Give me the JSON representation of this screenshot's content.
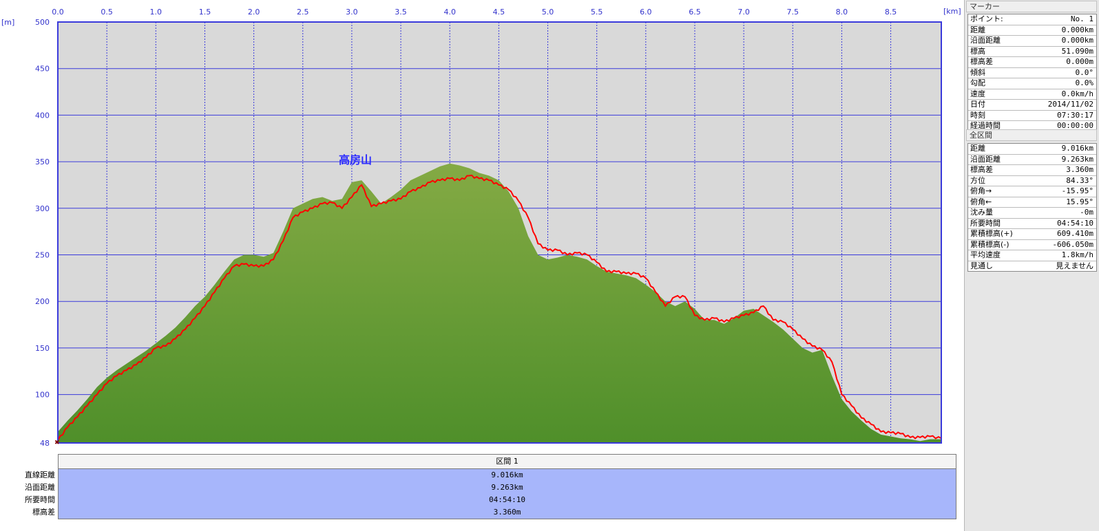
{
  "chart_data": {
    "type": "area",
    "title": "高房山",
    "x_unit": "[km]",
    "y_unit": "[m]",
    "xlim": [
      0,
      9.016
    ],
    "ylim": [
      48,
      500
    ],
    "x_ticks": [
      "0.0",
      "0.5",
      "1.0",
      "1.5",
      "2.0",
      "2.5",
      "3.0",
      "3.5",
      "4.0",
      "4.5",
      "5.0",
      "5.5",
      "6.0",
      "6.5",
      "7.0",
      "7.5",
      "8.0",
      "8.5"
    ],
    "y_ticks": [
      "500",
      "450",
      "400",
      "350",
      "300",
      "250",
      "200",
      "150",
      "100",
      "48"
    ],
    "grid": true,
    "series": [
      {
        "style": "area",
        "color": "#6b9a3a",
        "x": [
          0,
          0.1,
          0.2,
          0.3,
          0.4,
          0.5,
          0.6,
          0.7,
          0.8,
          0.9,
          1.0,
          1.1,
          1.2,
          1.3,
          1.4,
          1.5,
          1.6,
          1.7,
          1.8,
          1.9,
          2.0,
          2.1,
          2.2,
          2.3,
          2.4,
          2.5,
          2.6,
          2.7,
          2.8,
          2.9,
          3.0,
          3.1,
          3.2,
          3.3,
          3.4,
          3.5,
          3.6,
          3.7,
          3.8,
          3.9,
          4.0,
          4.1,
          4.2,
          4.3,
          4.4,
          4.5,
          4.6,
          4.7,
          4.8,
          4.9,
          5.0,
          5.1,
          5.2,
          5.3,
          5.4,
          5.5,
          5.6,
          5.7,
          5.8,
          5.9,
          6.0,
          6.1,
          6.2,
          6.3,
          6.4,
          6.5,
          6.6,
          6.7,
          6.8,
          6.9,
          7.0,
          7.1,
          7.2,
          7.3,
          7.4,
          7.5,
          7.6,
          7.7,
          7.8,
          7.9,
          8.0,
          8.1,
          8.2,
          8.3,
          8.4,
          8.5,
          8.6,
          8.7,
          8.8,
          8.9,
          9.016
        ],
        "y": [
          60,
          72,
          83,
          95,
          108,
          118,
          126,
          133,
          140,
          147,
          155,
          163,
          172,
          183,
          195,
          205,
          218,
          232,
          245,
          250,
          250,
          248,
          252,
          275,
          300,
          305,
          310,
          312,
          308,
          310,
          328,
          330,
          318,
          305,
          312,
          320,
          330,
          335,
          340,
          345,
          348,
          346,
          343,
          338,
          335,
          330,
          318,
          300,
          270,
          250,
          245,
          247,
          250,
          248,
          245,
          238,
          232,
          230,
          228,
          225,
          218,
          210,
          200,
          195,
          200,
          192,
          180,
          180,
          176,
          182,
          190,
          192,
          185,
          178,
          170,
          160,
          150,
          145,
          148,
          120,
          95,
          82,
          72,
          63,
          57,
          55,
          53,
          52,
          50,
          52,
          52
        ]
      },
      {
        "style": "line",
        "color": "#ff0000",
        "x": [
          0,
          0.1,
          0.2,
          0.3,
          0.4,
          0.5,
          0.6,
          0.7,
          0.8,
          0.9,
          1.0,
          1.1,
          1.2,
          1.3,
          1.4,
          1.5,
          1.6,
          1.7,
          1.8,
          1.9,
          2.0,
          2.1,
          2.2,
          2.3,
          2.4,
          2.5,
          2.6,
          2.7,
          2.8,
          2.9,
          3.0,
          3.1,
          3.2,
          3.3,
          3.4,
          3.5,
          3.6,
          3.7,
          3.8,
          3.9,
          4.0,
          4.1,
          4.2,
          4.3,
          4.4,
          4.5,
          4.6,
          4.7,
          4.8,
          4.9,
          5.0,
          5.1,
          5.2,
          5.3,
          5.4,
          5.5,
          5.6,
          5.7,
          5.8,
          5.9,
          6.0,
          6.1,
          6.2,
          6.3,
          6.4,
          6.5,
          6.6,
          6.7,
          6.8,
          6.9,
          7.0,
          7.1,
          7.2,
          7.3,
          7.4,
          7.5,
          7.6,
          7.7,
          7.8,
          7.9,
          8.0,
          8.1,
          8.2,
          8.3,
          8.4,
          8.5,
          8.6,
          8.7,
          8.8,
          8.9,
          9.016
        ],
        "y": [
          51,
          65,
          76,
          88,
          100,
          112,
          120,
          126,
          132,
          140,
          150,
          152,
          160,
          170,
          182,
          195,
          210,
          225,
          238,
          240,
          238,
          238,
          245,
          265,
          290,
          296,
          300,
          305,
          306,
          300,
          312,
          325,
          302,
          305,
          308,
          310,
          318,
          322,
          328,
          330,
          332,
          330,
          335,
          332,
          330,
          325,
          320,
          308,
          290,
          262,
          255,
          255,
          250,
          252,
          250,
          242,
          232,
          232,
          230,
          230,
          225,
          210,
          195,
          205,
          205,
          185,
          180,
          182,
          178,
          182,
          185,
          188,
          195,
          180,
          178,
          170,
          160,
          152,
          148,
          135,
          100,
          88,
          75,
          68,
          60,
          59,
          58,
          54,
          54,
          55,
          53
        ]
      }
    ]
  },
  "summary": {
    "header": "区間 1",
    "rows": [
      {
        "label": "直線距離",
        "value": "9.016km"
      },
      {
        "label": "沿面距離",
        "value": "9.263km"
      },
      {
        "label": "所要時間",
        "value": "04:54:10"
      },
      {
        "label": "標高差",
        "value": "3.360m"
      }
    ]
  },
  "marker_panel": {
    "header": "マーカー",
    "rows": [
      {
        "k": "ポイント:",
        "v": "No. 1"
      },
      {
        "k": "距離",
        "v": "0.000km"
      },
      {
        "k": "沿面距離",
        "v": "0.000km"
      },
      {
        "k": "標高",
        "v": "51.090m"
      },
      {
        "k": "標高差",
        "v": "0.000m"
      },
      {
        "k": "傾斜",
        "v": "0.0°"
      },
      {
        "k": "勾配",
        "v": "0.0%"
      },
      {
        "k": "速度",
        "v": "0.0km/h"
      },
      {
        "k": "日付",
        "v": "2014/11/02"
      },
      {
        "k": "時刻",
        "v": "07:30:17"
      },
      {
        "k": "経過時間",
        "v": "00:00:00"
      }
    ]
  },
  "range_panel": {
    "header": "全区間",
    "rows": [
      {
        "k": "距離",
        "v": "9.016km"
      },
      {
        "k": "沿面距離",
        "v": "9.263km"
      },
      {
        "k": "標高差",
        "v": "3.360m"
      },
      {
        "k": "方位",
        "v": "84.33°"
      },
      {
        "k": "俯角→",
        "v": "-15.95°"
      },
      {
        "k": "俯角←",
        "v": "15.95°"
      },
      {
        "k": "沈み量",
        "v": "-0m"
      },
      {
        "k": "所要時間",
        "v": "04:54:10"
      },
      {
        "k": "累積標高(+)",
        "v": "609.410m"
      },
      {
        "k": "累積標高(-)",
        "v": "-606.050m"
      },
      {
        "k": "平均速度",
        "v": "1.8km/h"
      },
      {
        "k": "見通し",
        "v": "見えません"
      }
    ]
  }
}
